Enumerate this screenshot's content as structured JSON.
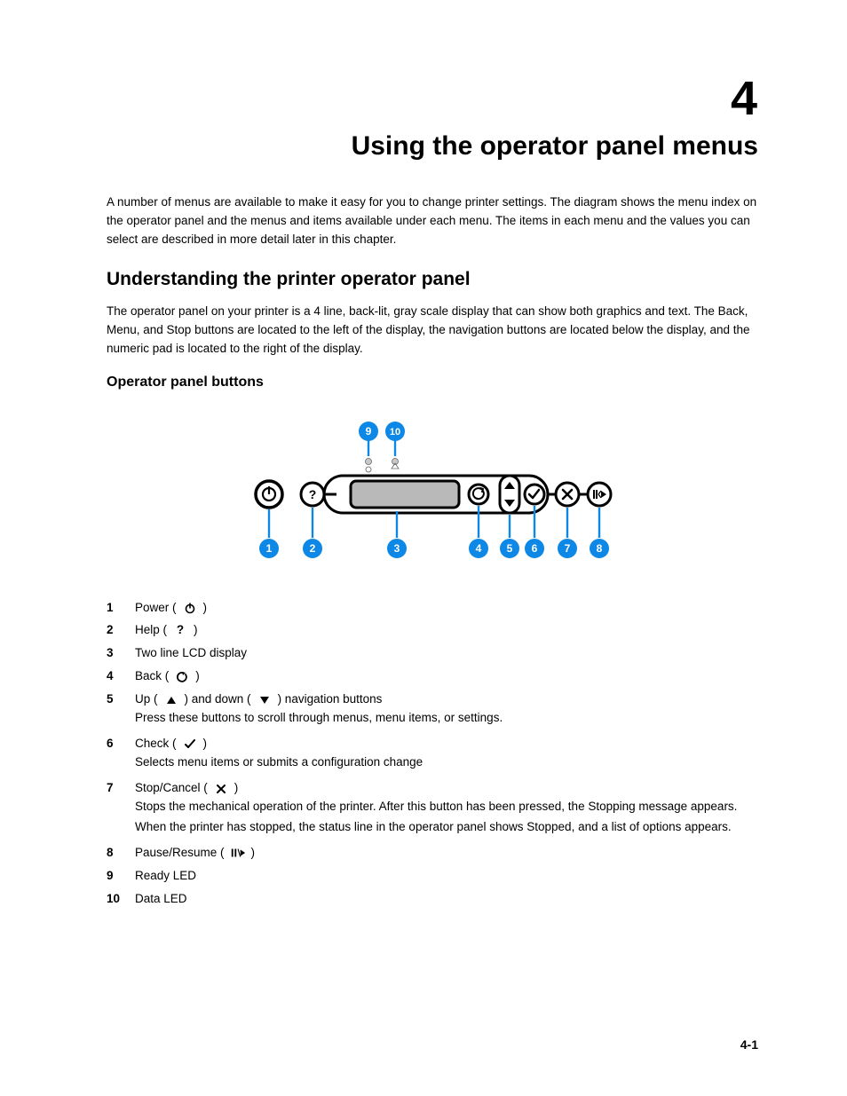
{
  "chapter_number": "4",
  "chapter_title": "Using the operator panel menus",
  "intro_paragraph": "A number of menus are available to make it easy for you to change printer settings. The diagram shows the menu index on the operator panel and the menus and items available under each menu. The items in each menu and the values you can select are described in more detail later in this chapter.",
  "section_title": "Understanding the printer operator panel",
  "section_text": "The operator panel on your printer is a 4 line, back-lit, gray scale display that can show both graphics and text. The Back, Menu, and Stop buttons are located to the left of the display, the navigation buttons are located below the display, and the numeric pad is located to the right of the display.",
  "subsection_title": "Operator panel buttons",
  "legend": [
    {
      "num": "1",
      "label_before": "Power (",
      "icon": "power-icon",
      "label_after": ")"
    },
    {
      "num": "2",
      "label_before": "Help (",
      "icon": "question-icon",
      "label_after": ")"
    },
    {
      "num": "3",
      "label_text": "Two line LCD display"
    },
    {
      "num": "4",
      "label_before": "Back (",
      "icon": "back-icon",
      "label_after": ")"
    },
    {
      "num": "5",
      "label_before": "Up (",
      "icon": "up-icon",
      "label_mid": ") and down (",
      "icon2": "down-icon",
      "label_after": ") navigation buttons",
      "desc": "Press these buttons to scroll through menus, menu items, or settings."
    },
    {
      "num": "6",
      "label_before": "Check (",
      "icon": "check-icon",
      "label_after": ")",
      "desc": "Selects menu items or submits a configuration change"
    },
    {
      "num": "7",
      "label_before": "Stop/Cancel (",
      "icon": "stop-icon",
      "label_after": ")",
      "desc": "Stops the mechanical operation of the printer. After this button has been pressed, the Stopping message appears. When the printer has stopped, the status line in the operator panel shows Stopped, and a list of options appears."
    },
    {
      "num": "8",
      "label_before": "Pause/Resume (",
      "icon": "pause-resume-icon",
      "label_after": ")"
    },
    {
      "num": "9",
      "label_text": "Ready LED"
    },
    {
      "num": "10",
      "label_text": "Data LED"
    }
  ],
  "callouts_bottom": [
    "1",
    "2",
    "3",
    "4",
    "5",
    "6",
    "7",
    "8"
  ],
  "callouts_top": [
    "9",
    "10"
  ],
  "page_number": "4-1",
  "colors": {
    "accent": "#0d88e6",
    "callout_fill": "#0d88e6",
    "callout_text": "#ffffff"
  }
}
